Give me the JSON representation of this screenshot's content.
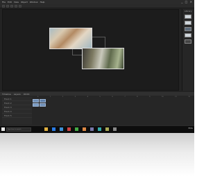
{
  "menubar": {
    "items": [
      "File",
      "Edit",
      "View",
      "Object",
      "Window",
      "Help"
    ],
    "controls": "_ □ ×"
  },
  "right_panel": {
    "header": "Library"
  },
  "timeline": {
    "header_labels": [
      "Timeline",
      "Layers",
      "00:00"
    ],
    "tracks": [
      "Track 1",
      "Track 2",
      "Track 3",
      "Track 4",
      "Track 5"
    ],
    "ruler_ticks": [
      "0",
      "1",
      "2",
      "3",
      "4",
      "5",
      "6",
      "7",
      "8",
      "9",
      "10",
      "11",
      "12"
    ]
  },
  "taskbar": {
    "search_placeholder": "Type here to search",
    "tray_text": "ENG",
    "icons": [
      {
        "name": "file-explorer-icon",
        "color": "#e0b040"
      },
      {
        "name": "browser-icon",
        "color": "#2a7be4"
      },
      {
        "name": "mail-icon",
        "color": "#3c8fd6"
      },
      {
        "name": "app-icon-1",
        "color": "#c44"
      },
      {
        "name": "app-icon-2",
        "color": "#4a4"
      },
      {
        "name": "app-icon-3",
        "color": "#d84"
      },
      {
        "name": "app-icon-4",
        "color": "#77a"
      },
      {
        "name": "app-icon-5",
        "color": "#3aa"
      },
      {
        "name": "app-icon-6",
        "color": "#aa5"
      },
      {
        "name": "app-icon-7",
        "color": "#888"
      }
    ]
  }
}
